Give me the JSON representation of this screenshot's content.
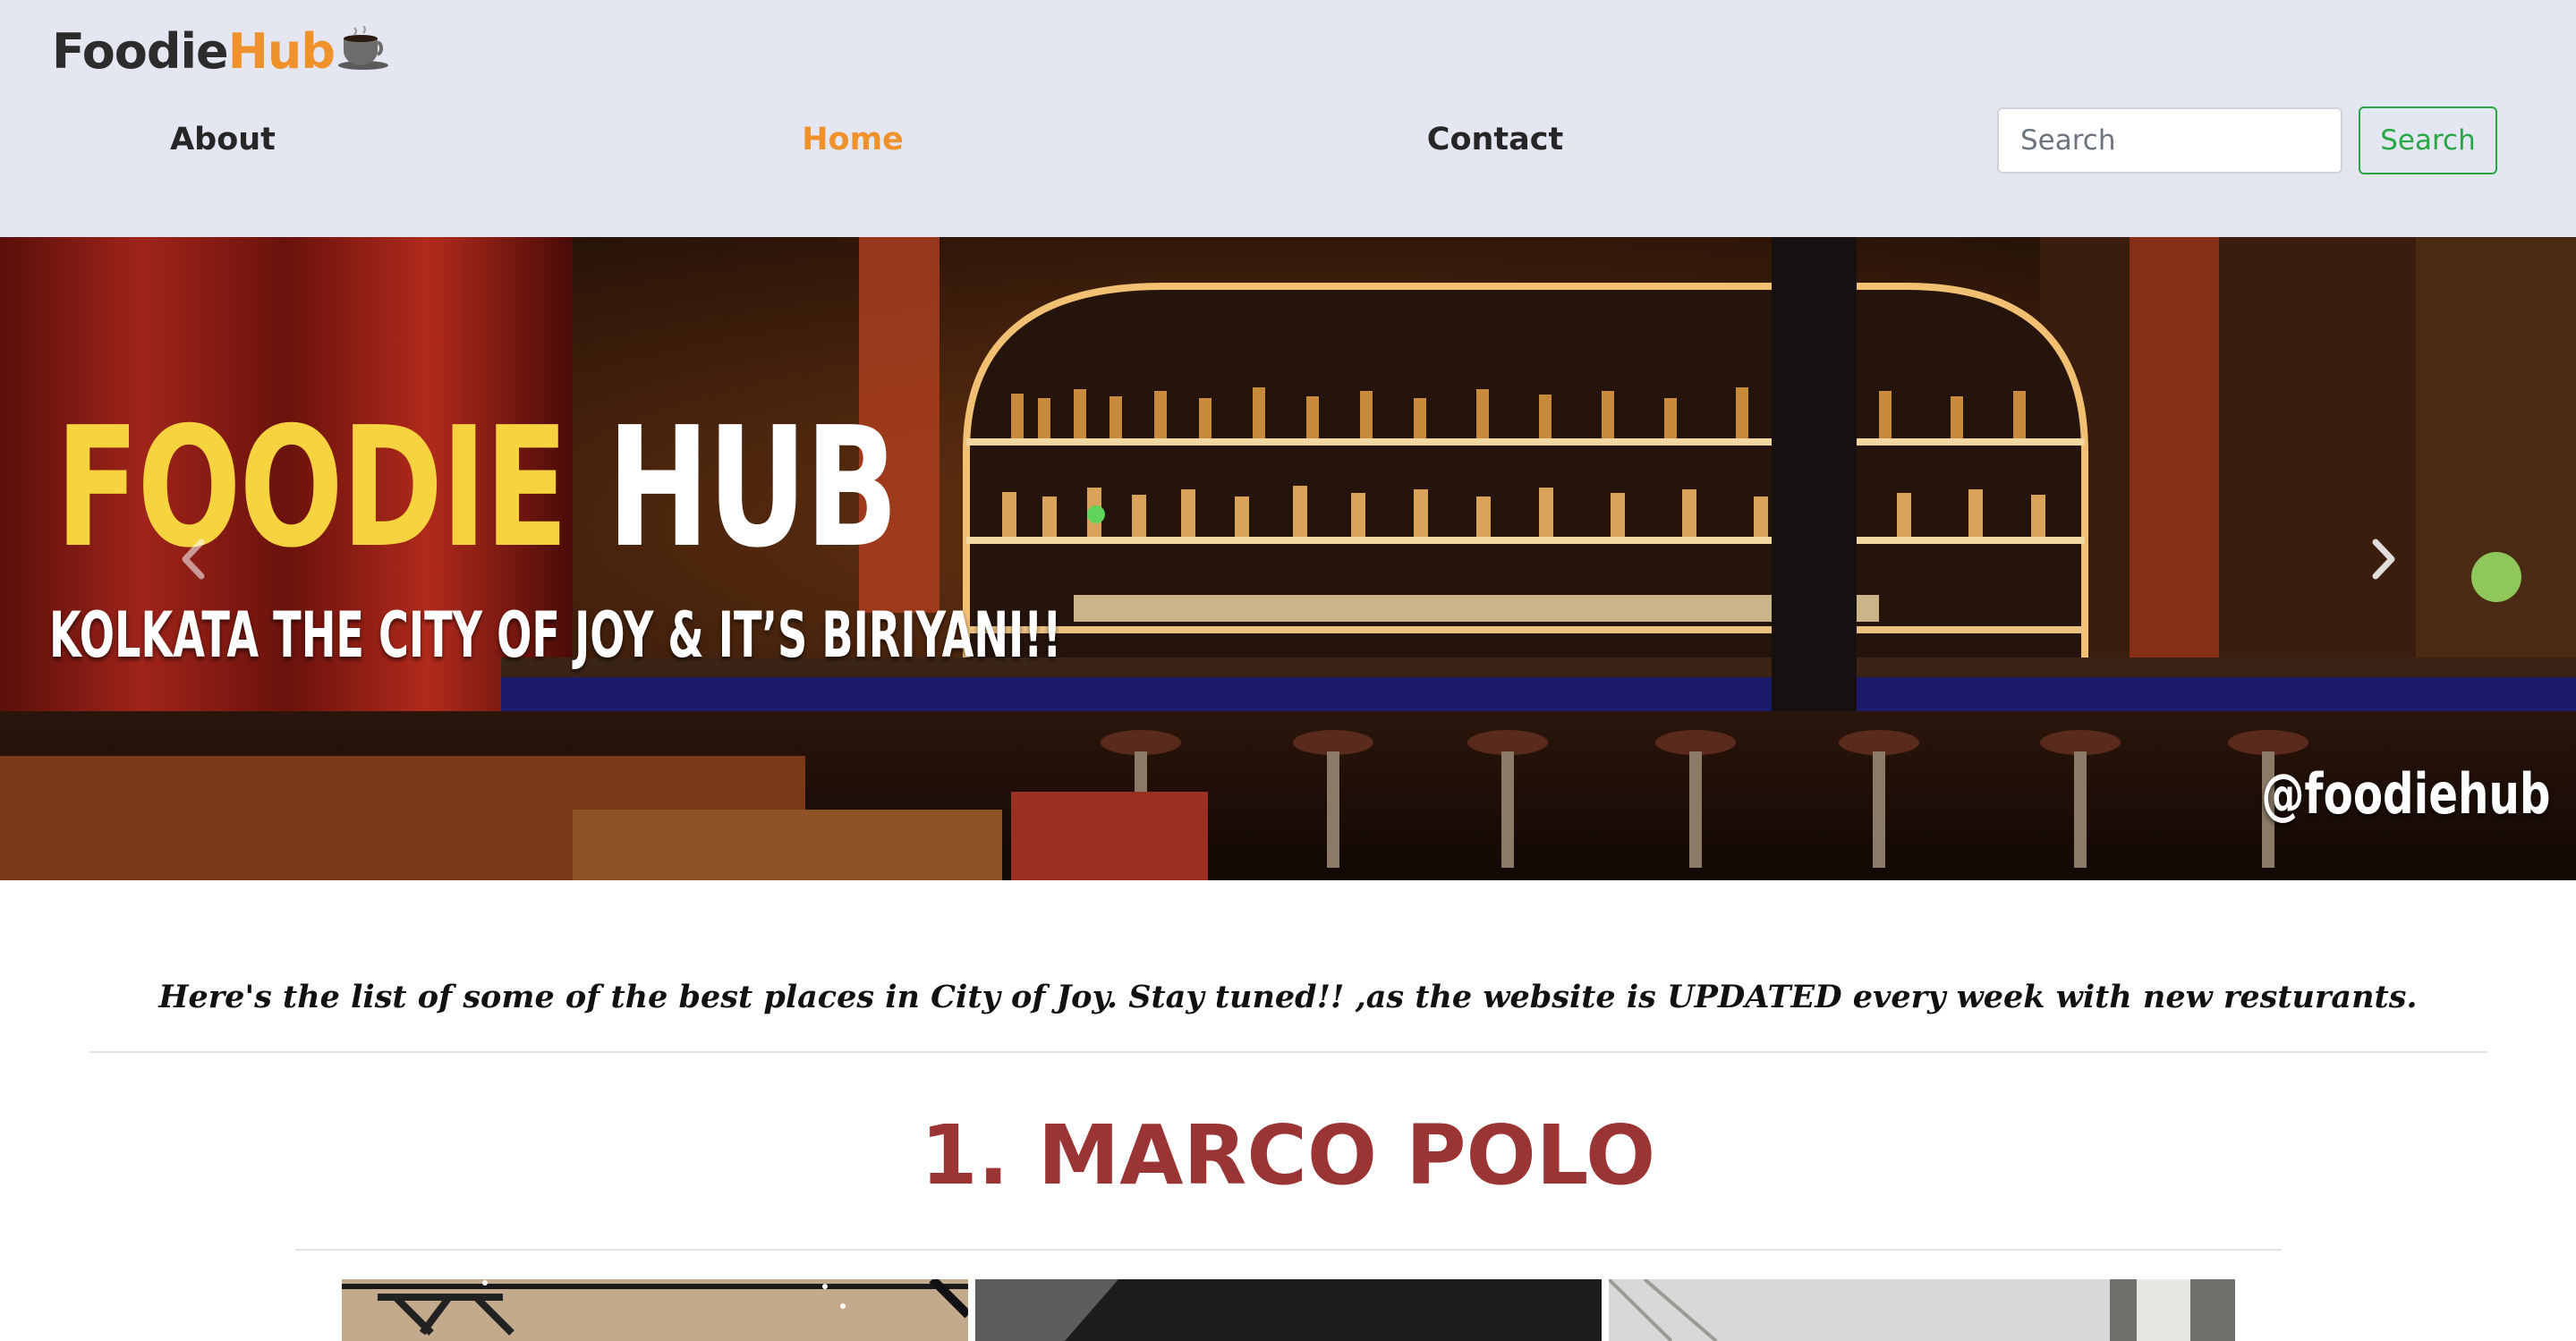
{
  "navbar": {
    "brand": {
      "part1": "Foodie",
      "part2": "Hub",
      "icon": "coffee-cup-icon"
    },
    "links": [
      {
        "label": "About",
        "active": false
      },
      {
        "label": "Home",
        "active": true
      },
      {
        "label": "Contact",
        "active": false
      }
    ],
    "search": {
      "placeholder": "Search",
      "button_label": "Search"
    },
    "colors": {
      "background": "#e4e7f2",
      "accent": "#f0922b",
      "search_button": "#28a745"
    }
  },
  "hero": {
    "title_part1": "FOODIE",
    "title_part2": "HUB",
    "subtitle": "KOLKATA THE CITY OF JOY & IT’S BIRIYANI!!",
    "handle": "@foodiehub",
    "controls": {
      "prev_icon": "chevron-left-icon",
      "next_icon": "chevron-right-icon"
    },
    "colors": {
      "title_yellow": "#f7d33f",
      "title_white": "#ffffff"
    }
  },
  "intro": {
    "text": "Here's the list of some of the best places in City of Joy. Stay tuned!! ,as the website is UPDATED every week with new resturants."
  },
  "restaurant": {
    "heading": "1. MARCO POLO",
    "heading_color": "#9b3434",
    "gallery_count": 3
  }
}
